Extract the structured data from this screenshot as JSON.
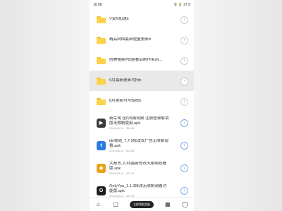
{
  "status": {
    "time": "16:58",
    "right": "令 🔋 27.5"
  },
  "items": [
    {
      "kind": "folder",
      "name": "V赏N加速b",
      "meta": ""
    },
    {
      "kind": "folder",
      "name": "精品网络最新程量更新b",
      "meta": ""
    },
    {
      "kind": "folder",
      "name": "防腾搜索内5题看后刷作关闭...",
      "meta": ""
    },
    {
      "kind": "folder",
      "name": "9月最新更新均持b",
      "meta": ""
    },
    {
      "kind": "folder",
      "name": "8月更新均与短视b",
      "meta": ""
    },
    {
      "kind": "app",
      "name": "新芽淘 全0风模视频 注册登录解锁版无限制使用.apk",
      "meta": "2024-08-14 · 28.5M",
      "color": "#3a3a3a",
      "glyph": "▶"
    },
    {
      "kind": "app",
      "name": "tiki视频_7.7.0修改去广告无限制观看.apk",
      "meta": "2024-08-14 · 56.2M",
      "color": "#2a7be0",
      "glyph": "t"
    },
    {
      "kind": "app",
      "name": "大都市_6.65最新修改无限制观看版.apk",
      "meta": "2024-08-14 · 42.1M",
      "color": "#e8a317",
      "glyph": "◆"
    },
    {
      "kind": "app",
      "name": "OnlyYou_1.1.3修改无限制观看功能版.apk",
      "meta": "2024-08-14 · 33.7M",
      "color": "#1d1d1d",
      "glyph": "O"
    }
  ],
  "bottom": {
    "pill_label": "立即领取奖励"
  },
  "colors": {
    "folder": "#fbd24a",
    "accent": "#4a80d8"
  }
}
